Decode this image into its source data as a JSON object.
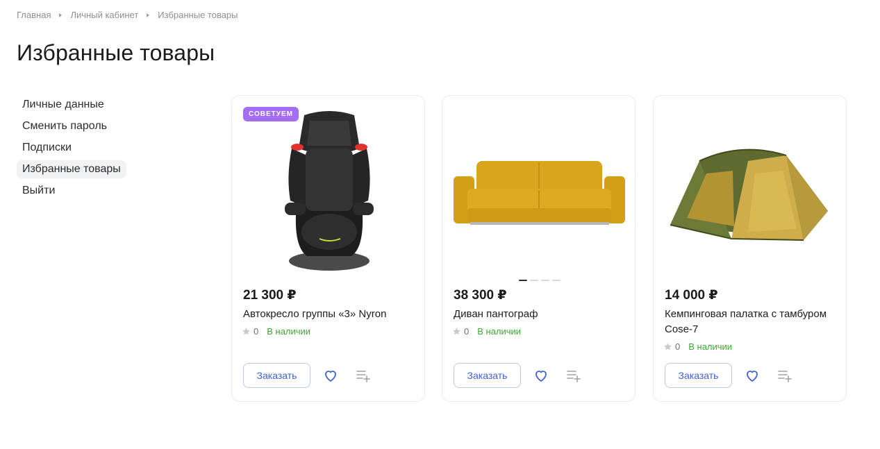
{
  "breadcrumb": [
    "Главная",
    "Личный кабинет",
    "Избранные товары"
  ],
  "page_title": "Избранные товары",
  "sidebar": {
    "items": [
      {
        "label": "Личные данные",
        "active": false
      },
      {
        "label": "Сменить пароль",
        "active": false
      },
      {
        "label": "Подписки",
        "active": false
      },
      {
        "label": "Избранные товары",
        "active": true
      },
      {
        "label": "Выйти",
        "active": false
      }
    ]
  },
  "products": [
    {
      "badge": "СОВЕТУЕМ",
      "image_icon": "car-seat-image",
      "price": "21 300 ₽",
      "name": "Автокресло группы «3» Nyron",
      "rating": "0",
      "stock": "В наличии",
      "order_label": "Заказать"
    },
    {
      "image_icon": "sofa-image",
      "price": "38 300 ₽",
      "name": "Диван пантограф",
      "rating": "0",
      "stock": "В наличии",
      "order_label": "Заказать"
    },
    {
      "image_icon": "tent-image",
      "price": "14 000 ₽",
      "name": "Кемпинговая палатка с тамбуром Cose-7",
      "rating": "0",
      "stock": "В наличии",
      "order_label": "Заказать"
    }
  ],
  "colors": {
    "accent": "#3e62d6",
    "badge": "#a56df4",
    "in_stock": "#3fa635"
  }
}
